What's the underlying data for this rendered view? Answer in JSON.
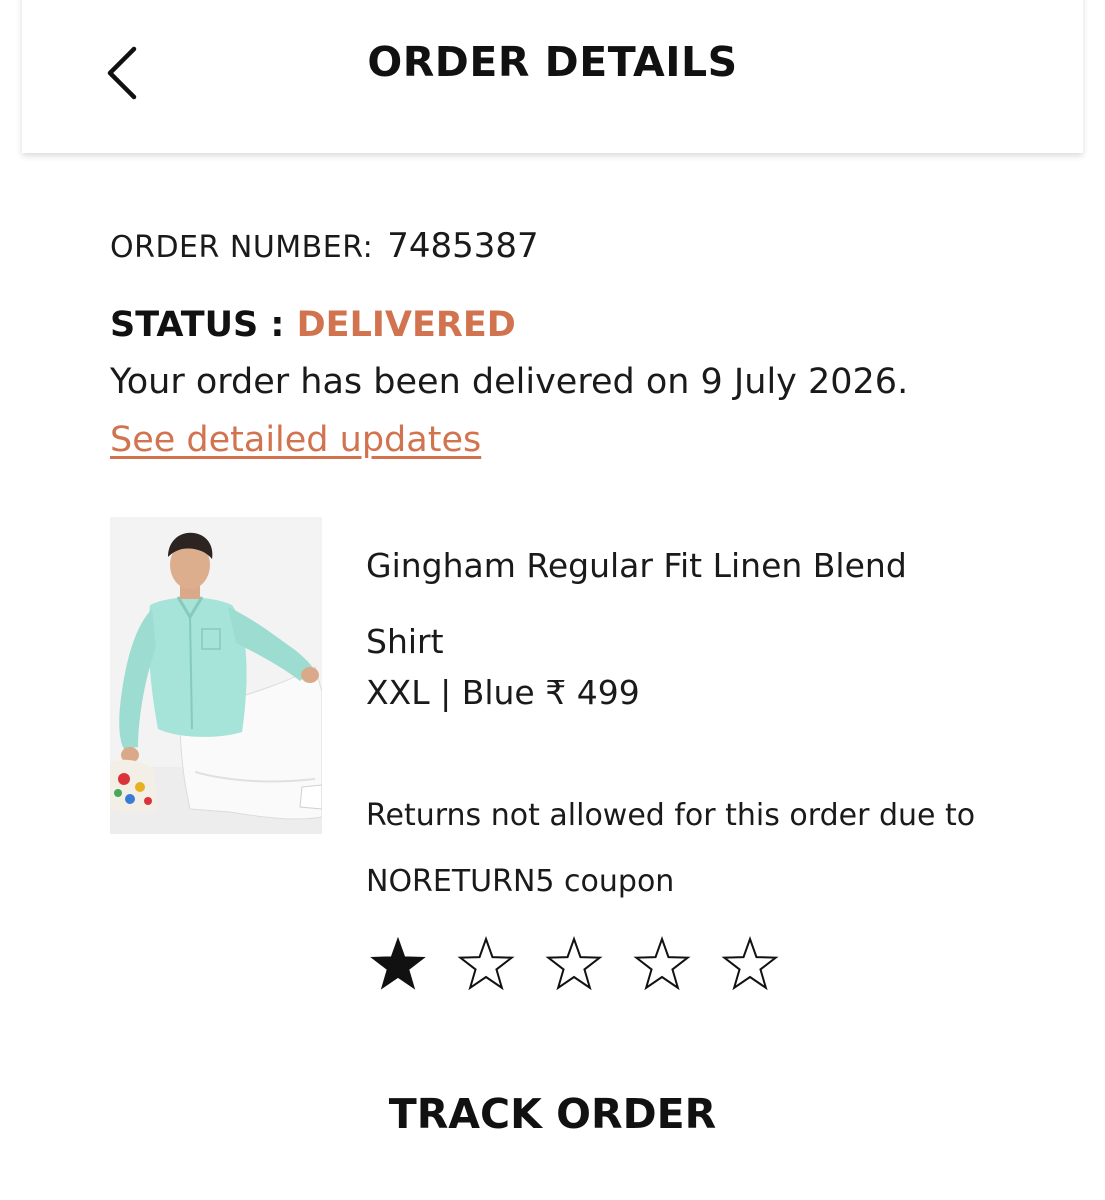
{
  "header": {
    "title": "ORDER DETAILS",
    "back_icon": "chevron-left-icon"
  },
  "order": {
    "number_label": "ORDER NUMBER:",
    "number_value": "7485387",
    "status_label": "STATUS :",
    "status_value": "DELIVERED",
    "status_message": "Your order has been delivered on 9 July 2026.",
    "updates_link": "See detailed updates"
  },
  "product": {
    "name": "Gingham Regular Fit Linen Blend Shirt",
    "meta": "XXL | Blue ₹ 499",
    "returns_note": "Returns not allowed for this order due to NORETURN5 coupon",
    "image_icon": "product-photo"
  },
  "rating": {
    "value": 1,
    "max": 5
  },
  "actions": {
    "track_order": "TRACK ORDER"
  },
  "colors": {
    "accent": "#d2734f",
    "text": "#111111"
  }
}
